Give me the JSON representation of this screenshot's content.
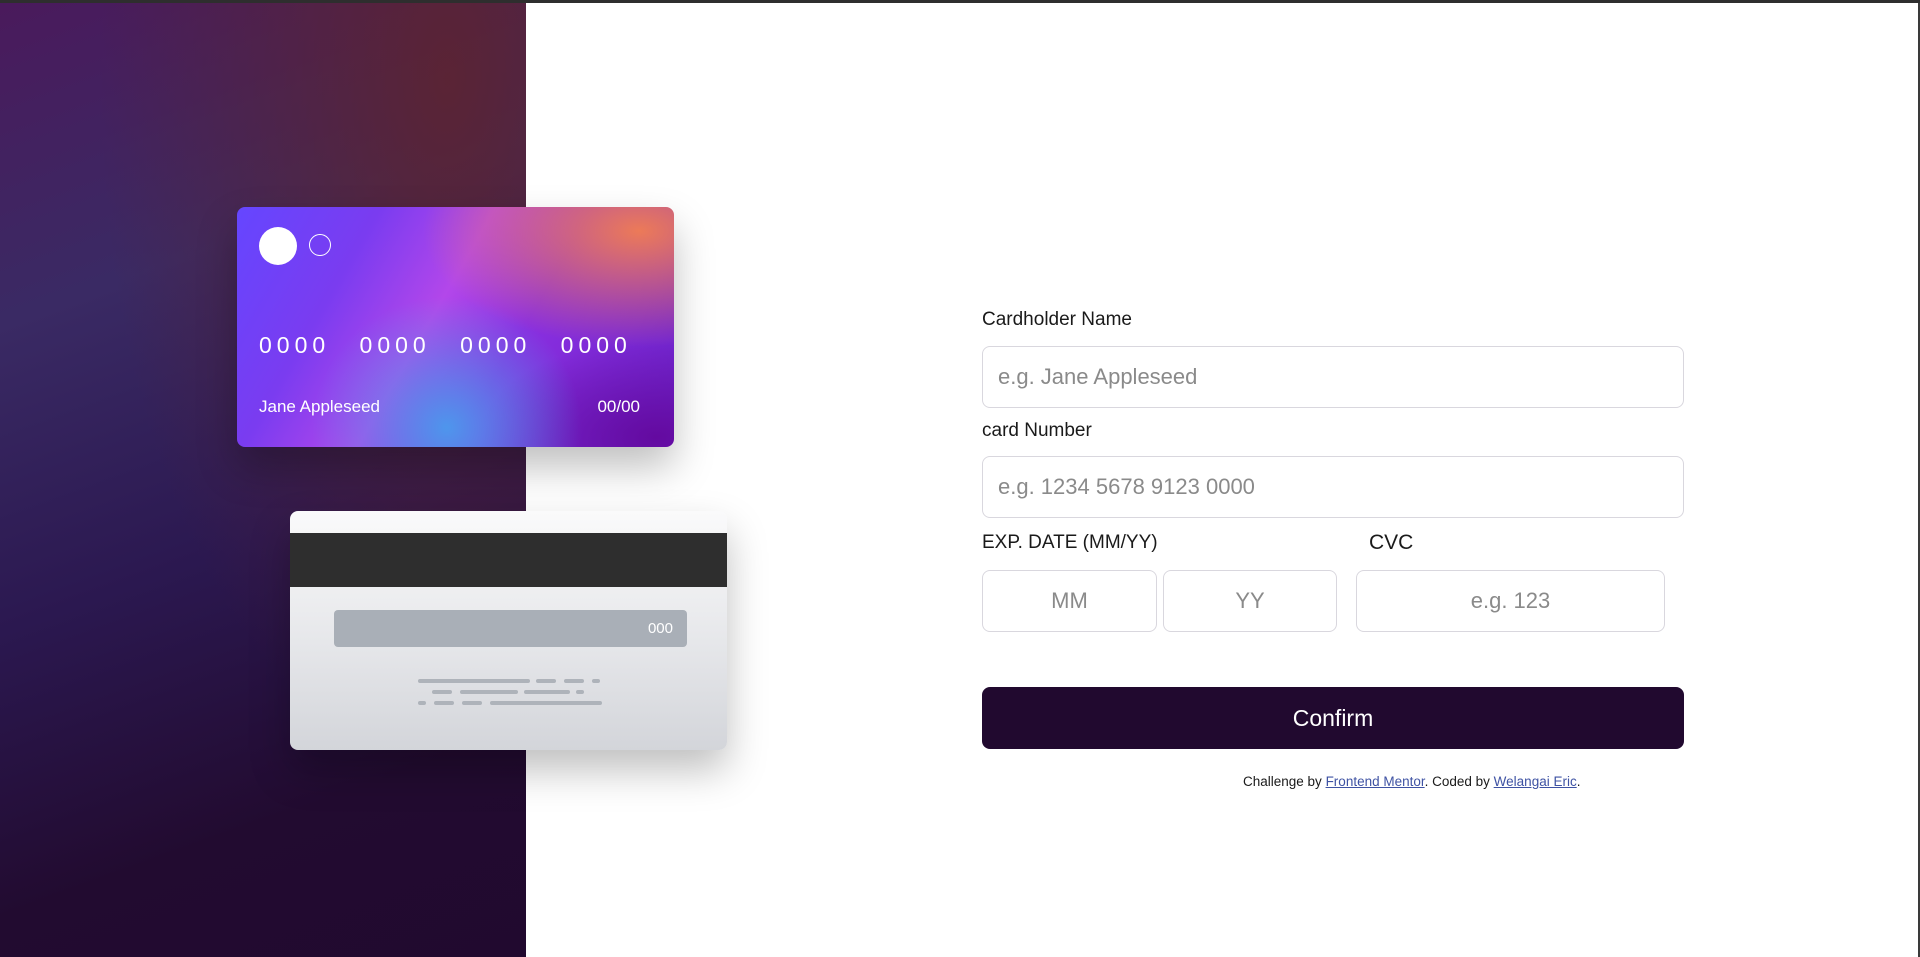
{
  "card_front": {
    "number": "0000 0000 0000 0000",
    "holder": "Jane Appleseed",
    "expiry": "00/00"
  },
  "card_back": {
    "cvc": "000"
  },
  "form": {
    "cardholder_label": "Cardholder Name",
    "cardholder_placeholder": "e.g. Jane Appleseed",
    "number_label": "card Number",
    "number_placeholder": "e.g. 1234 5678 9123 0000",
    "exp_label": "EXP. DATE (MM/YY)",
    "month_placeholder": "MM",
    "year_placeholder": "YY",
    "cvc_label": "CVC",
    "cvc_placeholder": "e.g. 123",
    "confirm_label": "Confirm"
  },
  "attribution": {
    "prefix": "Challenge by ",
    "link1": "Frontend Mentor",
    "middle": ". Coded by ",
    "link2": "Welangai Eric",
    "suffix": "."
  },
  "colors": {
    "side_panel_dark": "#21092f",
    "button_bg": "#21092f",
    "link": "#3e52a3",
    "input_border": "#d9d7de"
  }
}
